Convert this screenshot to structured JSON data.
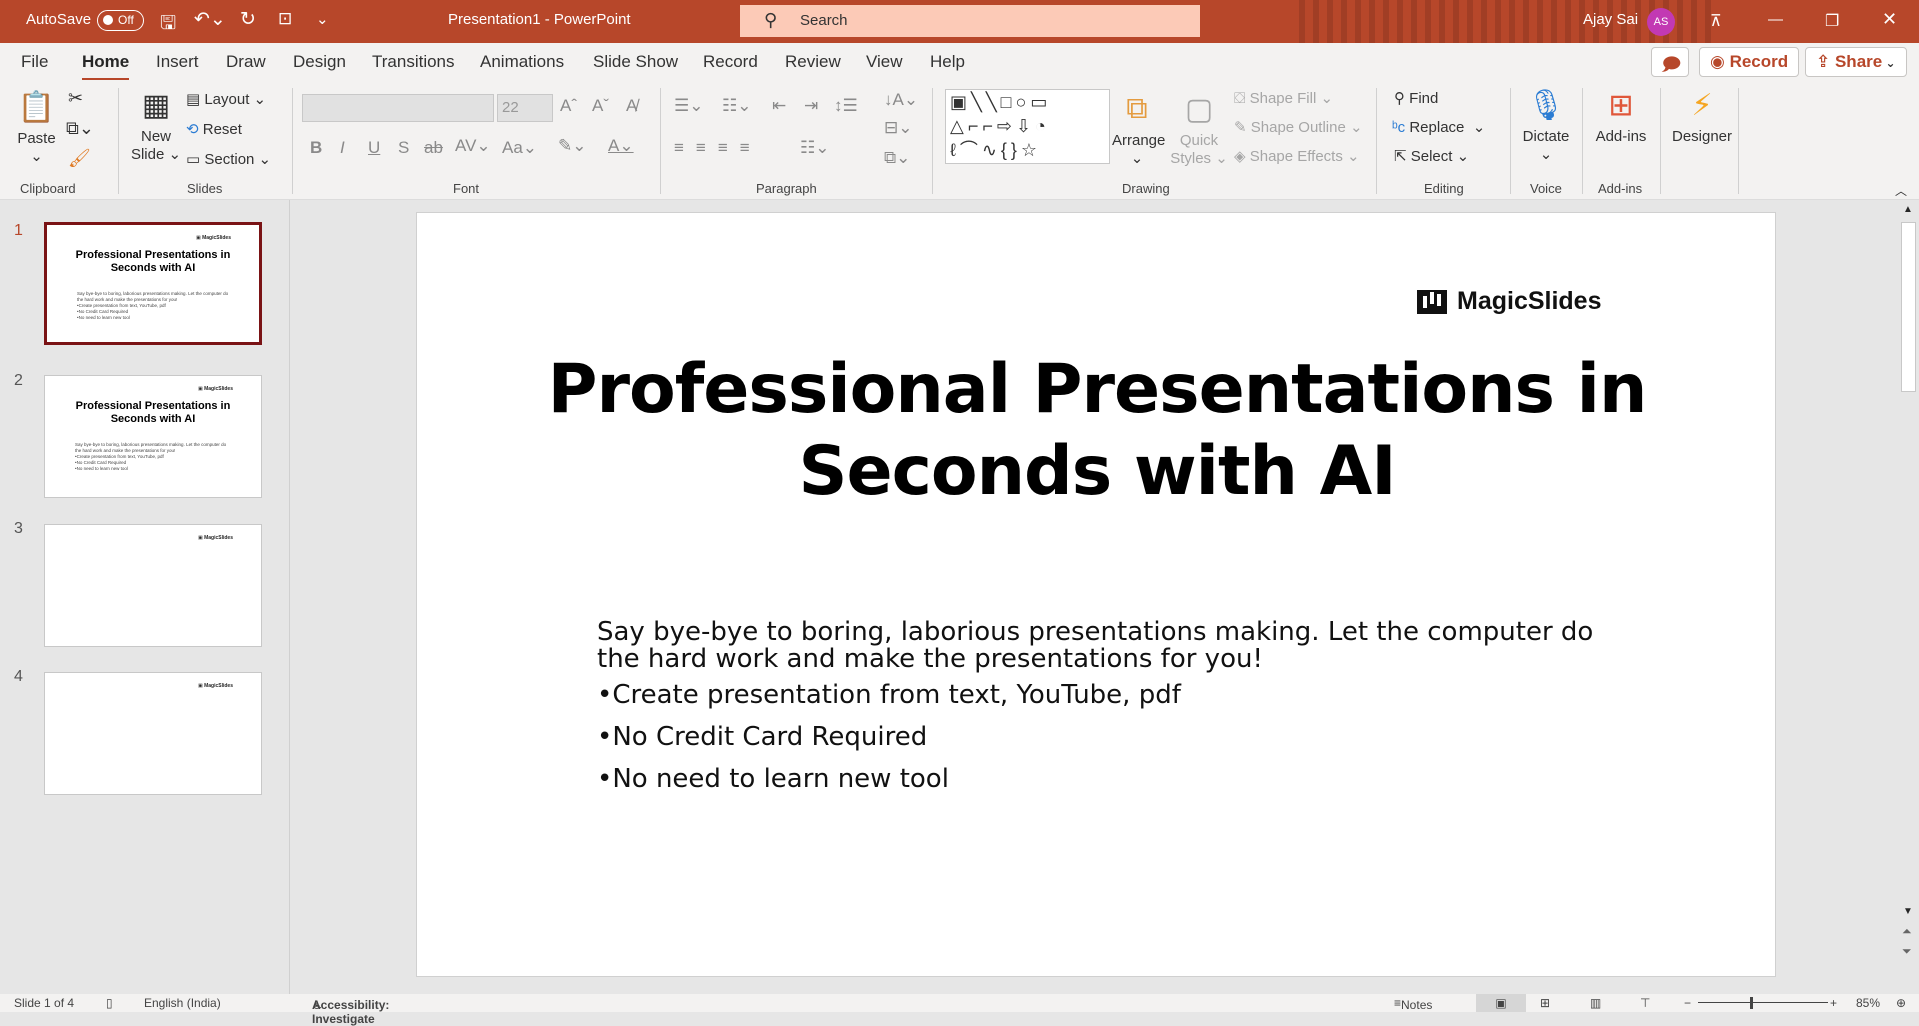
{
  "titlebar": {
    "autosave_label": "AutoSave",
    "autosave_state": "Off",
    "title": "Presentation1  -  PowerPoint",
    "search_placeholder": "Search",
    "user_name": "Ajay Sai",
    "user_initials": "AS",
    "accent": "#b7472a"
  },
  "menu": {
    "tabs": [
      "File",
      "Home",
      "Insert",
      "Draw",
      "Design",
      "Transitions",
      "Animations",
      "Slide Show",
      "Record",
      "Review",
      "View",
      "Help"
    ],
    "active": "Home",
    "record_label": "Record",
    "share_label": "Share"
  },
  "ribbon": {
    "clipboard": {
      "label": "Clipboard",
      "paste": "Paste"
    },
    "slides": {
      "label": "Slides",
      "new_slide_1": "New",
      "new_slide_2": "Slide",
      "layout": "Layout",
      "reset": "Reset",
      "section": "Section"
    },
    "font": {
      "label": "Font",
      "size": "22"
    },
    "paragraph": {
      "label": "Paragraph"
    },
    "drawing": {
      "label": "Drawing",
      "arrange": "Arrange",
      "quick_styles_1": "Quick",
      "quick_styles_2": "Styles",
      "shape_fill": "Shape Fill",
      "shape_outline": "Shape Outline",
      "shape_effects": "Shape Effects"
    },
    "editing": {
      "label": "Editing",
      "find": "Find",
      "replace": "Replace",
      "select": "Select"
    },
    "voice": {
      "label": "Voice",
      "dictate": "Dictate"
    },
    "addins": {
      "label": "Add-ins",
      "addins": "Add-ins"
    },
    "designer": {
      "label": "Designer"
    }
  },
  "thumbnails": [
    {
      "number": "1"
    },
    {
      "number": "2"
    },
    {
      "number": "3"
    },
    {
      "number": "4"
    }
  ],
  "slide": {
    "logo": "MagicSlides",
    "title_line1": "Professional Presentations in",
    "title_line2": "Seconds with AI",
    "intro_line1": "Say bye-bye to boring, laborious presentations making. Let the computer do",
    "intro_line2": "the hard work and make the presentations for you!",
    "bullets": [
      "•Create presentation from text, YouTube, pdf",
      "•No Credit Card Required",
      "•No need to learn new tool"
    ]
  },
  "status": {
    "slide_count": "Slide 1 of 4",
    "language": "English (India)",
    "accessibility": "Accessibility: Investigate",
    "notes": "Notes",
    "zoom": "85%"
  }
}
